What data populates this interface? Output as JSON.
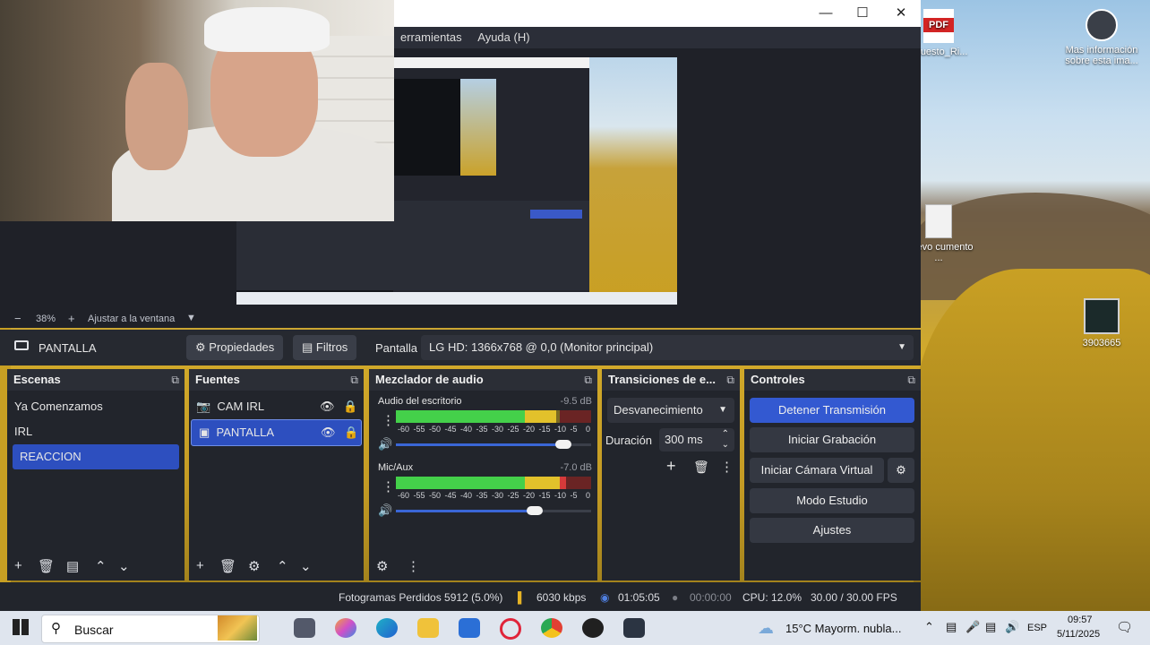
{
  "desktop": {
    "icons": [
      {
        "label": "upuesto_Ri..."
      },
      {
        "label": "Mas información sobre esta ima..."
      },
      {
        "label": "Nuevo cumento ..."
      },
      {
        "label": "3903665"
      }
    ],
    "pdf_badge": "PDF"
  },
  "window": {
    "menu": [
      "erramientas",
      "Ayuda (H)"
    ]
  },
  "preview": {
    "zoom": "38%",
    "fit_label": "Ajustar a la ventana"
  },
  "source_bar": {
    "source_name": "PANTALLA",
    "properties_label": "Propiedades",
    "filters_label": "Filtros",
    "screen_label": "Pantalla",
    "screen_value": "LG HD: 1366x768 @ 0,0 (Monitor principal)"
  },
  "scenes": {
    "title": "Escenas",
    "items": [
      "Ya Comenzamos",
      "IRL",
      "REACCION"
    ],
    "selected_index": 2
  },
  "sources": {
    "title": "Fuentes",
    "items": [
      {
        "name": "CAM IRL",
        "icon": "camera-icon"
      },
      {
        "name": "PANTALLA",
        "icon": "monitor-icon"
      }
    ]
  },
  "mixer": {
    "title": "Mezclador de audio",
    "channels": [
      {
        "name": "Audio del escritorio",
        "db": "-9.5 dB",
        "level": 0.82,
        "volume": 0.86
      },
      {
        "name": "Mic/Aux",
        "db": "-7.0 dB",
        "level": 0.87,
        "volume": 0.71
      }
    ],
    "scale": [
      "-60",
      "-55",
      "-50",
      "-45",
      "-40",
      "-35",
      "-30",
      "-25",
      "-20",
      "-15",
      "-10",
      "-5",
      "0"
    ]
  },
  "transitions": {
    "title": "Transiciones de e...",
    "selected": "Desvanecimiento",
    "duration_label": "Duración",
    "duration_value": "300 ms"
  },
  "controls": {
    "title": "Controles",
    "stop_stream": "Detener Transmisión",
    "start_record": "Iniciar Grabación",
    "virtual_cam": "Iniciar Cámara Virtual",
    "studio_mode": "Modo Estudio",
    "settings": "Ajustes"
  },
  "status": {
    "dropped": "Fotogramas Perdidos 5912 (5.0%)",
    "bitrate": "6030 kbps",
    "stream_time": "01:05:05",
    "record_time": "00:00:00",
    "cpu": "CPU: 12.0%",
    "fps": "30.00 / 30.00 FPS"
  },
  "taskbar": {
    "search_placeholder": "Buscar",
    "weather": "15°C  Mayorm. nubla...",
    "lang": "ESP",
    "time": "09:57",
    "date": "5/11/2025"
  }
}
